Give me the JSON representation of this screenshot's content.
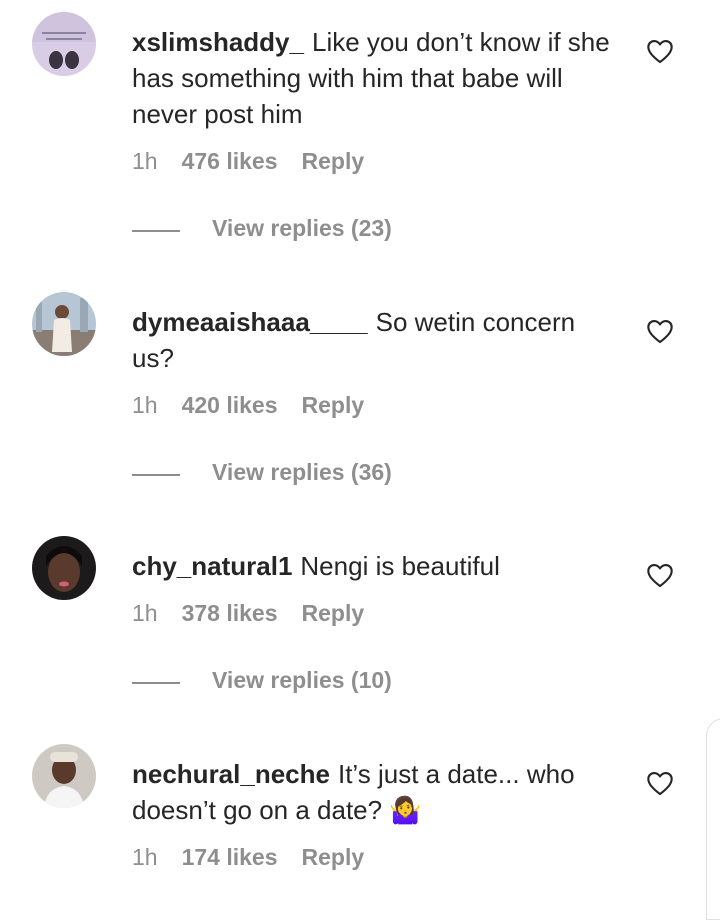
{
  "comments": [
    {
      "username": "xslimshaddy_",
      "text": "Like you don’t know if she has something with him that babe will never post him",
      "time": "1h",
      "likes": "476 likes",
      "reply": "Reply",
      "view_replies": "View replies (23)"
    },
    {
      "username": "dymeaaishaaa____",
      "text": "So wetin concern us?",
      "time": "1h",
      "likes": "420 likes",
      "reply": "Reply",
      "view_replies": "View replies (36)"
    },
    {
      "username": "chy_natural1",
      "text": "Nengi is beautiful",
      "time": "1h",
      "likes": "378 likes",
      "reply": "Reply",
      "view_replies": "View replies (10)"
    },
    {
      "username": "nechural_neche",
      "text": "It’s just a date... who doesn’t go on a date? 🤷‍♀️",
      "time": "1h",
      "likes": "174 likes",
      "reply": "Reply"
    }
  ],
  "icons": {
    "like": "heart-outline-icon"
  }
}
